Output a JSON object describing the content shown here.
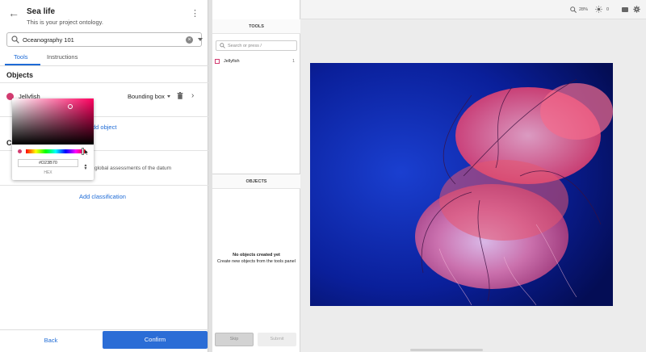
{
  "header": {
    "title": "Sea life",
    "subtitle": "This is your project ontology."
  },
  "ontology_select": {
    "value": "Oceanography 101"
  },
  "tabs": [
    {
      "label": "Tools",
      "active": true
    },
    {
      "label": "Instructions",
      "active": false
    }
  ],
  "objects": {
    "heading": "Objects",
    "items": [
      {
        "name": "Jellyfish",
        "color": "#D23B70",
        "type": "Bounding box"
      }
    ],
    "add_label": "dd object"
  },
  "classifications": {
    "heading": "Cl",
    "description": "global assessments of the datum",
    "add_label": "Add classification"
  },
  "color_picker": {
    "hex_value": "#D23B70",
    "hex_label": "HEX"
  },
  "footer": {
    "back_label": "Back",
    "confirm_label": "Confirm"
  },
  "tools_panel": {
    "heading": "TOOLS",
    "search_placeholder": "Search or press /",
    "items": [
      {
        "name": "Jellyfish",
        "shortcut": "1",
        "color": "#D23B70"
      }
    ]
  },
  "objects_panel": {
    "heading": "OBJECTS",
    "empty_title": "No objects created yet",
    "empty_hint": "Create new objects from the tools panel"
  },
  "label_actions": {
    "skip_label": "Skip",
    "submit_label": "Submit"
  },
  "canvas_toolbar": {
    "zoom": "28%",
    "brightness": "0",
    "icons": [
      "zoom-icon",
      "brightness-icon",
      "keyboard-icon",
      "settings-gear-icon"
    ]
  },
  "colors": {
    "accent": "#1e6bd6",
    "confirm_button": "#2b6dd6",
    "object_color": "#D23B70"
  }
}
